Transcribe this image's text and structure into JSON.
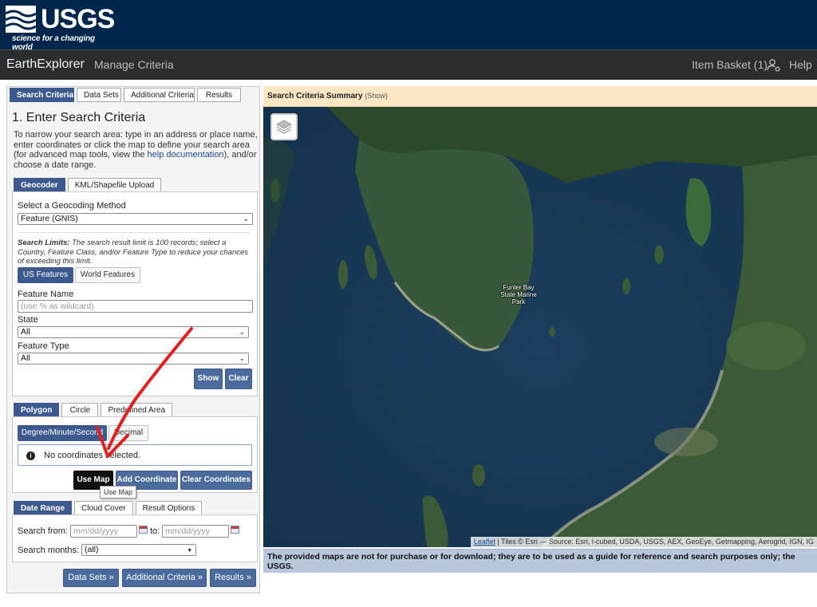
{
  "brand": {
    "logo_text": "USGS",
    "tagline": "science for a changing world"
  },
  "nav": {
    "app_title": "EarthExplorer",
    "manage_criteria": "Manage Criteria",
    "item_basket": "Item Basket (1)",
    "help": "Help"
  },
  "main_tabs": [
    "Search Criteria",
    "Data Sets",
    "Additional Criteria",
    "Results"
  ],
  "search_criteria": {
    "title": "1. Enter Search Criteria",
    "intro_before": "To narrow your search area: type in an address or place name, enter coordinates or click the map to define your search area (for advanced map tools, view the ",
    "intro_link": "help documentation",
    "intro_after": "), and/or choose a date range."
  },
  "geocoder": {
    "tabs": [
      "Geocoder",
      "KML/Shapefile Upload"
    ],
    "method_label": "Select a Geocoding Method",
    "method_value": "Feature (GNIS)",
    "limits_bold": "Search Limits:",
    "limits_text": " The search result limit is 100 records; select a Country, Feature Class, and/or Feature Type to reduce your chances of exceeding this limit.",
    "scope_tabs": [
      "US Features",
      "World Features"
    ],
    "feature_name_label": "Feature Name",
    "feature_name_placeholder": "(use % as wildcard)",
    "state_label": "State",
    "state_value": "All",
    "feature_type_label": "Feature Type",
    "feature_type_value": "All",
    "show_button": "Show",
    "clear_button": "Clear"
  },
  "polygon": {
    "tabs": [
      "Polygon",
      "Circle",
      "Predefined Area"
    ],
    "format_tabs": [
      "Degree/Minute/Second",
      "Decimal"
    ],
    "no_coordinates": "No coordinates selected.",
    "use_map": "Use Map",
    "add_coordinate": "Add Coordinate",
    "clear_coordinates": "Clear Coordinates",
    "tooltip": "Use Map"
  },
  "date": {
    "tabs": [
      "Date Range",
      "Cloud Cover",
      "Result Options"
    ],
    "search_from_label": "Search from:",
    "from_placeholder": "mm/dd/yyyy",
    "to_label": "to:",
    "to_placeholder": "mm/dd/yyyy",
    "months_label": "Search months:",
    "months_value": "(all)"
  },
  "bottom_buttons": [
    "Data Sets »",
    "Additional Criteria »",
    "Results »"
  ],
  "map": {
    "summary_title": "Search Criteria Summary",
    "summary_show": "(Show)",
    "place_label": "Funter Bay State Marine Park",
    "attribution_link": "Leaflet",
    "attribution_text": " | Tiles © Esri — Source: Esri, i-cubed, USDA, USGS, AEX, GeoEye, Getmapping, Aerogrid, IGN, IG",
    "disclaimer": "The provided maps are not for purchase or for download; they are to be used as a guide for reference and search purposes only; the",
    "disclaimer_line2": "USGS."
  },
  "colors": {
    "header_bg": "#00264c",
    "nav_bg": "#2b2d30",
    "accent": "#3d5a8f",
    "summary_bg": "#fbe6c4",
    "arrow": "#e02020"
  }
}
